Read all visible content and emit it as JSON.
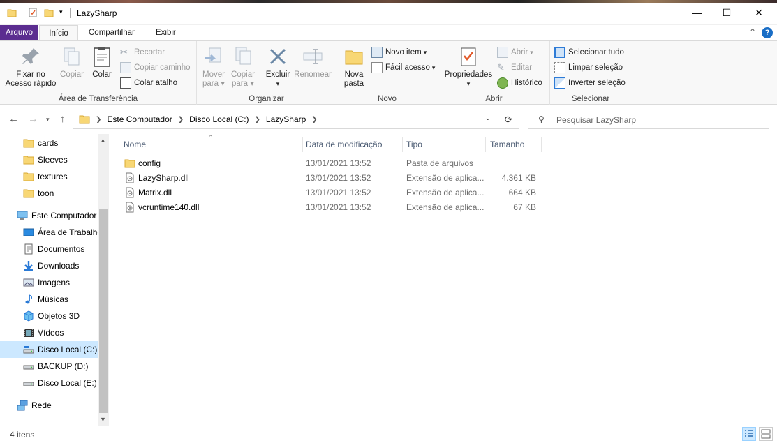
{
  "window": {
    "title": "LazySharp",
    "minimize_glyph": "—",
    "maximize_glyph": "☐",
    "close_glyph": "✕"
  },
  "ribbon_tabs": [
    "Arquivo",
    "Início",
    "Compartilhar",
    "Exibir"
  ],
  "ribbon": {
    "clipboard": {
      "label": "Área de Transferência",
      "pin": "Fixar no Acesso rápido",
      "pin_line1": "Fixar no",
      "pin_line2": "Acesso rápido",
      "copy": "Copiar",
      "paste": "Colar",
      "cut": "Recortar",
      "copy_path": "Copiar caminho",
      "paste_shortcut": "Colar atalho"
    },
    "organize": {
      "label": "Organizar",
      "move_line1": "Mover",
      "move_line2": "para",
      "copy_line1": "Copiar",
      "copy_line2": "para",
      "delete": "Excluir",
      "rename": "Renomear"
    },
    "new": {
      "label": "Novo",
      "folder_line1": "Nova",
      "folder_line2": "pasta",
      "new_item": "Novo item",
      "easy_access": "Fácil acesso"
    },
    "open": {
      "label": "Abrir",
      "properties": "Propriedades",
      "open": "Abrir",
      "edit": "Editar",
      "history": "Histórico"
    },
    "select": {
      "label": "Selecionar",
      "select_all": "Selecionar tudo",
      "select_none": "Limpar seleção",
      "invert": "Inverter seleção"
    }
  },
  "address": {
    "crumbs": [
      "Este Computador",
      "Disco Local (C:)",
      "LazySharp"
    ],
    "search_placeholder": "Pesquisar LazySharp"
  },
  "nav": {
    "items": [
      {
        "label": "cards",
        "icon": "folder-icon"
      },
      {
        "label": "Sleeves",
        "icon": "folder-icon"
      },
      {
        "label": "textures",
        "icon": "folder-icon"
      },
      {
        "label": "toon",
        "icon": "folder-icon"
      },
      {
        "label": "Este Computador",
        "icon": "computer-icon"
      },
      {
        "label": "Área de Trabalho",
        "icon": "desktop-icon"
      },
      {
        "label": "Documentos",
        "icon": "documents-icon"
      },
      {
        "label": "Downloads",
        "icon": "download-icon"
      },
      {
        "label": "Imagens",
        "icon": "pictures-icon"
      },
      {
        "label": "Músicas",
        "icon": "music-icon"
      },
      {
        "label": "Objetos 3D",
        "icon": "cube-icon"
      },
      {
        "label": "Vídeos",
        "icon": "video-icon"
      },
      {
        "label": "Disco Local (C:)",
        "icon": "drive-icon"
      },
      {
        "label": "BACKUP (D:)",
        "icon": "drive-icon"
      },
      {
        "label": "Disco Local (E:)",
        "icon": "drive-icon"
      },
      {
        "label": "Rede",
        "icon": "network-icon"
      }
    ]
  },
  "list": {
    "columns": [
      "Nome",
      "Data de modificação",
      "Tipo",
      "Tamanho"
    ],
    "rows": [
      {
        "name": "config",
        "date": "13/01/2021 13:52",
        "type": "Pasta de arquivos",
        "size": "",
        "icon": "folder-icon"
      },
      {
        "name": "LazySharp.dll",
        "date": "13/01/2021 13:52",
        "type": "Extensão de aplica...",
        "size": "4.361 KB",
        "icon": "dll-icon"
      },
      {
        "name": "Matrix.dll",
        "date": "13/01/2021 13:52",
        "type": "Extensão de aplica...",
        "size": "664 KB",
        "icon": "dll-icon"
      },
      {
        "name": "vcruntime140.dll",
        "date": "13/01/2021 13:52",
        "type": "Extensão de aplica...",
        "size": "67 KB",
        "icon": "dll-icon"
      }
    ]
  },
  "status": {
    "count": "4 itens"
  },
  "colors": {
    "file_tab": "#5b2d90",
    "selection": "#cce8ff",
    "folder": "#f8d775",
    "accent": "#1a6ec6"
  }
}
